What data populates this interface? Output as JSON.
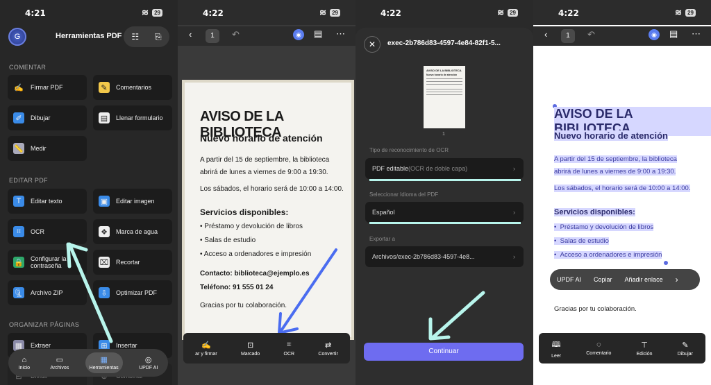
{
  "status": {
    "time_1": "4:21",
    "time_2": "4:22",
    "time_3": "4:22",
    "time_4": "4:22",
    "battery": "29"
  },
  "screen1": {
    "avatar_letter": "G",
    "title": "Herramientas PDF",
    "sections": {
      "comentar": "COMENTAR",
      "editar": "EDITAR PDF",
      "organizar": "ORGANIZAR PÁGINAS"
    },
    "tools": [
      {
        "label": "Firmar PDF"
      },
      {
        "label": "Comentarios"
      },
      {
        "label": "Dibujar"
      },
      {
        "label": "Llenar formulario"
      },
      {
        "label": "Medir"
      },
      {
        "label": "Editar texto"
      },
      {
        "label": "Editar imagen"
      },
      {
        "label": "OCR"
      },
      {
        "label": "Marca de agua"
      },
      {
        "label": "Configurar la contraseña"
      },
      {
        "label": "Recortar"
      },
      {
        "label": "Archivo ZIP"
      },
      {
        "label": "Optimizar PDF"
      },
      {
        "label": "Extraer"
      },
      {
        "label": "Insertar"
      },
      {
        "label": "Dividir"
      },
      {
        "label": "Combinar"
      }
    ],
    "tabs": [
      {
        "label": "Inicio",
        "icon": "home-icon"
      },
      {
        "label": "Archivos",
        "icon": "folder-icon"
      },
      {
        "label": "Herramientas",
        "icon": "tools-icon"
      },
      {
        "label": "UPDF AI",
        "icon": "ai-icon"
      }
    ]
  },
  "document": {
    "title": "AVISO DE LA BIBLIOTECA",
    "subtitle": "Nuevo horario de atención",
    "p1a": "A partir del 15 de septiembre, la biblioteca",
    "p1b": "abrirá de lunes a viernes de 9:00 a 19:30.",
    "p2": "Los sábados, el horario será de 10:00 a 14:00.",
    "services_title": "Servicios disponibles:",
    "services": [
      "Préstamo y devolución de libros",
      "Salas de estudio",
      "Acceso a ordenadores e impresión"
    ],
    "contact": "Contacto: biblioteca@ejemplo.es",
    "phone": "Teléfono: 91 555 01 24",
    "thanks": "Gracias por tu colaboración."
  },
  "screen2": {
    "page_number": "1",
    "toolbar": [
      {
        "label": "ar y firmar",
        "icon": "sign-icon"
      },
      {
        "label": "Marcado",
        "icon": "markup-icon"
      },
      {
        "label": "OCR",
        "icon": "ocr-icon"
      },
      {
        "label": "Convertir",
        "icon": "convert-icon"
      }
    ]
  },
  "screen3": {
    "filename": "exec-2b786d83-4597-4e84-82f1-5...",
    "thumb_page": "1",
    "ocr_type_label": "Tipo de reconocimiento de OCR",
    "ocr_type_value": "PDF editable",
    "ocr_type_hint": "(OCR de doble capa)",
    "lang_label": "Seleccionar Idioma del PDF",
    "lang_value": "Español",
    "export_label": "Exportar a",
    "export_value": "Archivos/exec-2b786d83-4597-4e8...",
    "continue": "Continuar"
  },
  "screen4": {
    "page_number": "1",
    "context_menu": [
      "UPDF AI",
      "Copiar",
      "Añadir enlace"
    ],
    "toolbar": [
      {
        "label": "Leer",
        "icon": "book-icon"
      },
      {
        "label": "Comentario",
        "icon": "comment-icon"
      },
      {
        "label": "Edición",
        "icon": "edit-icon"
      },
      {
        "label": "Dibujar",
        "icon": "pen-icon"
      }
    ]
  },
  "colors": {
    "accent": "#6e6cf0",
    "arrow": "#b8f5ec",
    "arrow_blue": "#4a6cf0",
    "highlight": "#d6d7ff"
  }
}
